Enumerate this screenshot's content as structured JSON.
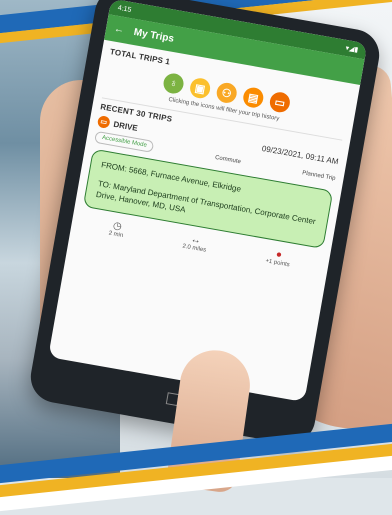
{
  "status_bar": {
    "time": "4:15",
    "icons": "signal-wifi-battery"
  },
  "app_bar": {
    "title": "My Trips",
    "back_icon": "arrow-left-icon"
  },
  "total_trips": {
    "label": "TOTAL TRIPS 1",
    "mode_icons": [
      {
        "name": "bike-icon",
        "color": "#7cb342",
        "glyph": "♁"
      },
      {
        "name": "transit-icon",
        "color": "#fbc02d",
        "glyph": "▣"
      },
      {
        "name": "carpool-icon",
        "color": "#f9a825",
        "glyph": "⚇"
      },
      {
        "name": "vanpool-icon",
        "color": "#fb8c00",
        "glyph": "▤"
      },
      {
        "name": "drive-icon",
        "color": "#ef6c00",
        "glyph": "▭"
      }
    ],
    "hint": "Clicking the icons will filter your trip history"
  },
  "recent_trips": {
    "label": "RECENT 30 TRIPS",
    "trip": {
      "mode": "DRIVE",
      "datetime": "09/23/2021, 09:11 AM",
      "tag_accessible": "Accessible Mode",
      "tag_commute": "Commute",
      "tag_planned": "Planned Trip",
      "from": "FROM: 5668, Furnace Avenue, Elkridge",
      "to": "TO: Maryland Department of Transportation, Corporate Center Drive, Hanover, MD, USA",
      "stats": [
        {
          "icon": "clock-icon",
          "glyph": "◷",
          "value": "2 min"
        },
        {
          "icon": "distance-icon",
          "glyph": "↔",
          "value": "2.0 miles"
        },
        {
          "icon": "points-icon",
          "glyph": "●",
          "value": "+1 points"
        }
      ]
    }
  }
}
